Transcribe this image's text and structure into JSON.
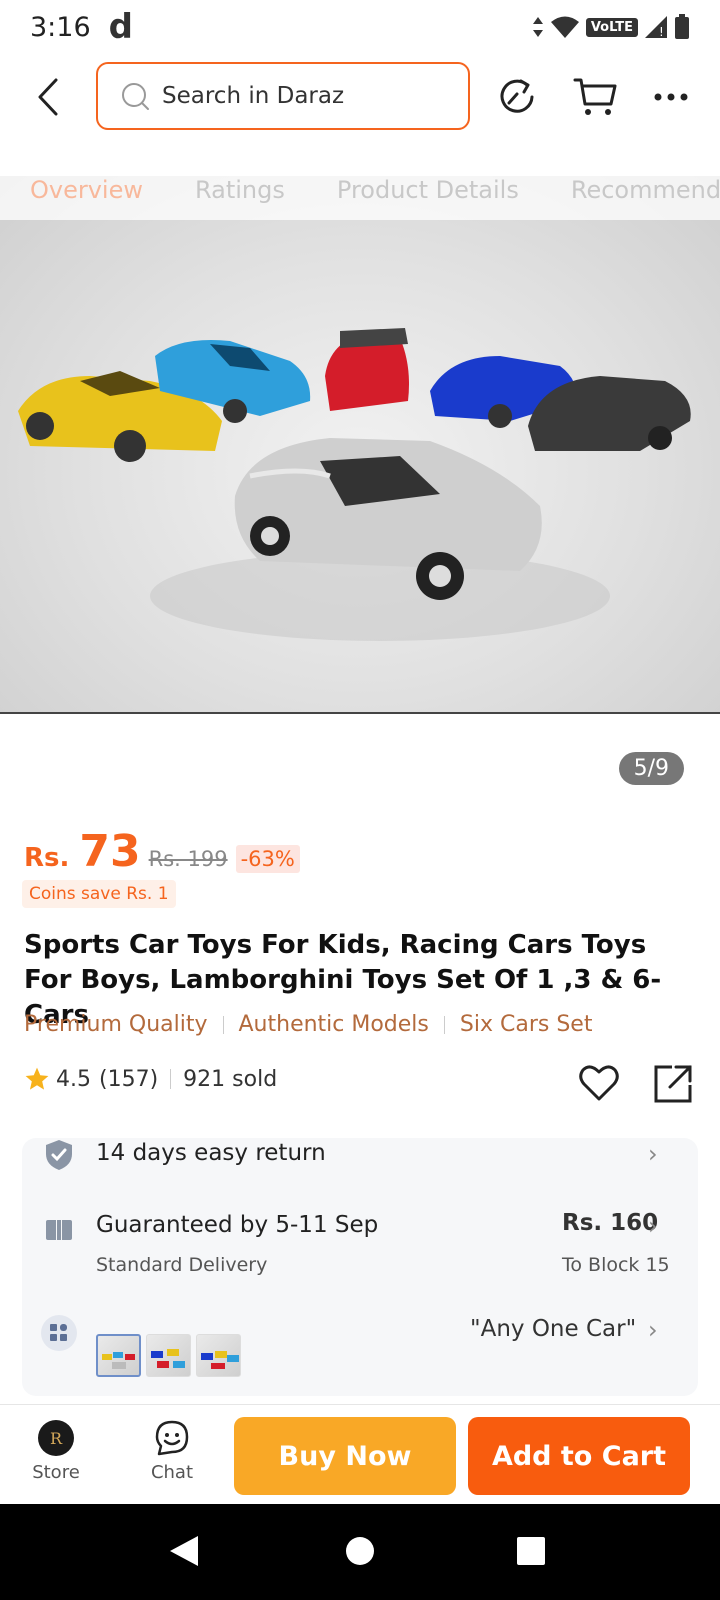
{
  "status": {
    "time": "3:16",
    "app_letter": "d",
    "network": "VoLTE"
  },
  "search": {
    "placeholder": "Search in Daraz"
  },
  "tabs": [
    {
      "label": "Overview",
      "active": true
    },
    {
      "label": "Ratings",
      "active": false
    },
    {
      "label": "Product Details",
      "active": false
    },
    {
      "label": "Recommended",
      "active": false
    }
  ],
  "gallery": {
    "pager": "5/9"
  },
  "price": {
    "currency": "Rs.",
    "current": "73",
    "original": "Rs. 199",
    "discount": "-63%",
    "coins": "Coins save Rs. 1"
  },
  "product": {
    "title": "Sports Car Toys For Kids, Racing Cars Toys For Boys, Lamborghini Toys Set Of 1 ,3 & 6-Cars",
    "highlights": [
      "Premium Quality",
      "Authentic Models",
      "Six Cars Set"
    ],
    "rating": "4.5",
    "reviews": "(157)",
    "sold": "921 sold"
  },
  "info": {
    "returns": "14 days easy return",
    "delivery_title": "Guaranteed by 5-11 Sep",
    "delivery_type": "Standard Delivery",
    "delivery_price": "Rs. 160",
    "delivery_location": "To Block 15",
    "variant": "\"Any One Car\""
  },
  "bottom": {
    "store": "Store",
    "chat": "Chat",
    "buy_now": "Buy Now",
    "add_to_cart": "Add to Cart"
  },
  "colors": {
    "accent": "#f5641e",
    "buy_now": "#f9a826",
    "add_to_cart": "#f85c0e",
    "highlight_text": "#b36a3c"
  }
}
